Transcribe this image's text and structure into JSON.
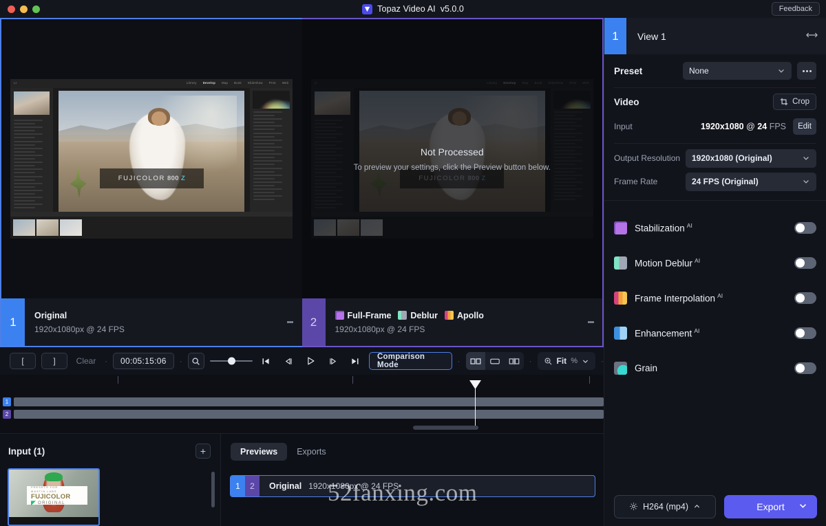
{
  "titlebar": {
    "app_name": "Topaz Video AI",
    "version": "v5.0.0",
    "feedback_label": "Feedback"
  },
  "viewer": {
    "right_pane_overlay": {
      "title": "Not Processed",
      "subtitle": "To preview your settings, click the Preview button below."
    },
    "panes": [
      {
        "number": "1",
        "label": "Original",
        "meta": "1920x1080px @ 24 FPS"
      },
      {
        "number": "2",
        "chips": [
          "Full-Frame",
          "Deblur",
          "Apollo"
        ],
        "meta": "1920x1080px @ 24 FPS"
      }
    ],
    "preview_image": {
      "fujicolor_word": "FUJICOLOR",
      "fujicolor_code": "800",
      "fujicolor_code_suffix": "Z",
      "lr_menu": [
        "Library",
        "Develop",
        "Map",
        "Book",
        "Slideshow",
        "Print",
        "Web"
      ]
    }
  },
  "transport": {
    "in_point": "[",
    "out_point": "]",
    "clear_label": "Clear",
    "timecode": "00:05:15:06",
    "comparison_mode_label": "Comparison Mode",
    "zoom_value": "Fit",
    "zoom_unit": "%"
  },
  "timeline": {
    "track_badges": [
      "1",
      "2"
    ]
  },
  "input_panel": {
    "title": "Input (1)",
    "add_label": "+",
    "thumbnail": {
      "brand_line_top": "MASTIN LABS",
      "brand_line_small": "PRESETS FOR",
      "brand": "FUJICOLOR",
      "brand_sub": "ORIGINAL"
    }
  },
  "previews_panel": {
    "tabs": [
      {
        "label": "Previews",
        "active": true
      },
      {
        "label": "Exports",
        "active": false
      }
    ],
    "row": {
      "badge_a": "1",
      "badge_b": "2",
      "label": "Original",
      "meta": "1920x1080px @ 24 FPS"
    }
  },
  "watermark": "52fanxing.com",
  "sidebar": {
    "view": {
      "number": "1",
      "name": "View 1"
    },
    "preset": {
      "label": "Preset",
      "value": "None"
    },
    "video": {
      "heading": "Video",
      "crop_label": "Crop",
      "input_label": "Input",
      "input_res": "1920x1080",
      "input_at": "@",
      "input_fps_num": "24",
      "input_fps_unit": "FPS",
      "edit_label": "Edit",
      "output_resolution_label": "Output Resolution",
      "output_resolution_value": "1920x1080 (Original)",
      "frame_rate_label": "Frame Rate",
      "frame_rate_value": "24 FPS (Original)"
    },
    "filters": [
      {
        "name": "Stabilization",
        "ai": "AI",
        "enabled": false,
        "icon": "stabilization-icon"
      },
      {
        "name": "Motion Deblur",
        "ai": "AI",
        "enabled": false,
        "icon": "motion-deblur-icon"
      },
      {
        "name": "Frame Interpolation",
        "ai": "AI",
        "enabled": false,
        "icon": "frame-interpolation-icon"
      },
      {
        "name": "Enhancement",
        "ai": "AI",
        "enabled": false,
        "icon": "enhancement-icon"
      },
      {
        "name": "Grain",
        "ai": "",
        "enabled": false,
        "icon": "grain-icon"
      }
    ],
    "export": {
      "codec_label": "H264 (mp4)",
      "export_label": "Export"
    }
  },
  "colors": {
    "accent_blue": "#3b82f0",
    "accent_purple": "#5b47a8",
    "export_purple": "#5b5bf0",
    "panel_bg": "#12141b"
  }
}
